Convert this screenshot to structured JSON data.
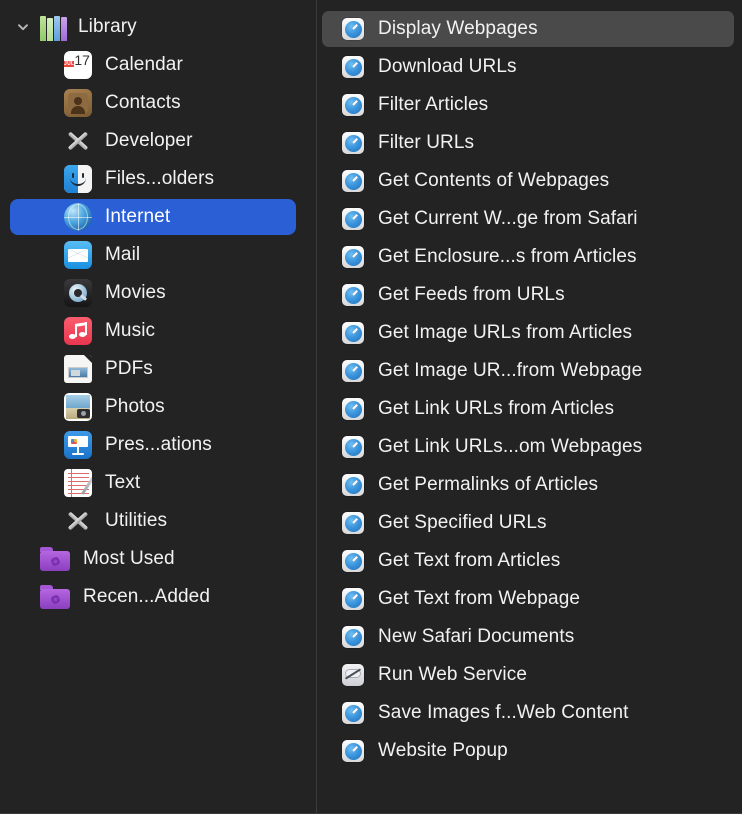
{
  "sidebar": {
    "header": {
      "label": "Library",
      "icon": "library-books-icon",
      "chevron": "chevron-down-icon"
    },
    "items": [
      {
        "label": "Calendar",
        "icon": "calendar-icon",
        "selected": false
      },
      {
        "label": "Contacts",
        "icon": "contacts-icon",
        "selected": false
      },
      {
        "label": "Developer",
        "icon": "tools-icon",
        "selected": false
      },
      {
        "label": "Files...olders",
        "icon": "finder-icon",
        "selected": false
      },
      {
        "label": "Internet",
        "icon": "globe-icon",
        "selected": true
      },
      {
        "label": "Mail",
        "icon": "mail-icon",
        "selected": false
      },
      {
        "label": "Movies",
        "icon": "quicktime-icon",
        "selected": false
      },
      {
        "label": "Music",
        "icon": "music-note-icon",
        "selected": false
      },
      {
        "label": "PDFs",
        "icon": "pdf-document-icon",
        "selected": false
      },
      {
        "label": "Photos",
        "icon": "photos-icon",
        "selected": false
      },
      {
        "label": "Pres...ations",
        "icon": "keynote-icon",
        "selected": false
      },
      {
        "label": "Text",
        "icon": "textedit-icon",
        "selected": false
      },
      {
        "label": "Utilities",
        "icon": "tools-icon",
        "selected": false
      }
    ],
    "groups": [
      {
        "label": "Most Used",
        "icon": "purple-gear-folder-icon"
      },
      {
        "label": "Recen...Added",
        "icon": "purple-gear-folder-icon"
      }
    ]
  },
  "actions": {
    "items": [
      {
        "label": "Display Webpages",
        "icon": "safari-action-icon",
        "selected": true
      },
      {
        "label": "Download URLs",
        "icon": "safari-action-icon",
        "selected": false
      },
      {
        "label": "Filter Articles",
        "icon": "safari-action-icon",
        "selected": false
      },
      {
        "label": "Filter URLs",
        "icon": "safari-action-icon",
        "selected": false
      },
      {
        "label": "Get Contents of Webpages",
        "icon": "safari-action-icon",
        "selected": false
      },
      {
        "label": "Get Current W...ge from Safari",
        "icon": "safari-action-icon",
        "selected": false
      },
      {
        "label": "Get Enclosure...s from Articles",
        "icon": "safari-action-icon",
        "selected": false
      },
      {
        "label": "Get Feeds from URLs",
        "icon": "safari-action-icon",
        "selected": false
      },
      {
        "label": "Get Image URLs from Articles",
        "icon": "safari-action-icon",
        "selected": false
      },
      {
        "label": "Get Image UR...from Webpage",
        "icon": "safari-action-icon",
        "selected": false
      },
      {
        "label": "Get Link URLs from Articles",
        "icon": "safari-action-icon",
        "selected": false
      },
      {
        "label": "Get Link URLs...om Webpages",
        "icon": "safari-action-icon",
        "selected": false
      },
      {
        "label": "Get Permalinks of Articles",
        "icon": "safari-action-icon",
        "selected": false
      },
      {
        "label": "Get Specified URLs",
        "icon": "safari-action-icon",
        "selected": false
      },
      {
        "label": "Get Text from Articles",
        "icon": "safari-action-icon",
        "selected": false
      },
      {
        "label": "Get Text from Webpage",
        "icon": "safari-action-icon",
        "selected": false
      },
      {
        "label": "New Safari Documents",
        "icon": "safari-action-icon",
        "selected": false
      },
      {
        "label": "Run Web Service",
        "icon": "web-service-icon",
        "selected": false
      },
      {
        "label": "Save Images f...Web Content",
        "icon": "safari-action-icon",
        "selected": false
      },
      {
        "label": "Website Popup",
        "icon": "safari-action-icon",
        "selected": false
      }
    ]
  },
  "colors": {
    "background": "#232323",
    "selection_blue": "#2a5fd6",
    "selection_gray": "#4a4a4a",
    "text": "#f2f2f2",
    "divider": "#3a3a3a"
  }
}
